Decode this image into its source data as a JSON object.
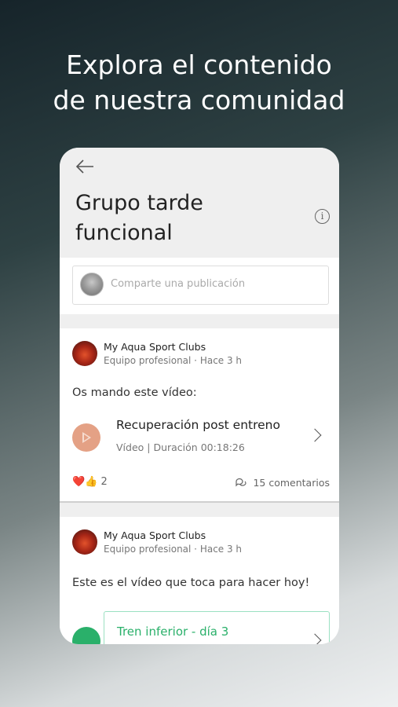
{
  "headline": {
    "line1": "Explora el contenido",
    "line2": "de nuestra comunidad"
  },
  "screen": {
    "title_line1": "Grupo tarde",
    "title_line2": "funcional",
    "composer_placeholder": "Comparte una publicación"
  },
  "posts": [
    {
      "author": "My Aqua Sport Clubs",
      "meta": "Equipo profesional · Hace 3 h",
      "text": "Os mando este vídeo:",
      "video_title": "Recuperación post entreno",
      "video_meta": "Vídeo | Duración 00:18:26",
      "reactions": "❤️👍",
      "reaction_count": "2",
      "comments": "15 comentarios"
    },
    {
      "author": "My Aqua Sport Clubs",
      "meta": "Equipo profesional · Hace 3 h",
      "text": "Este es el vídeo que toca para hacer hoy!",
      "workout_title": "Tren inferior - día 3"
    }
  ],
  "colors": {
    "accent_green": "#2ab06a",
    "play_button": "#e4a185"
  },
  "icons": {
    "back": "back-arrow-icon",
    "info": "info-icon",
    "play": "play-icon",
    "comment": "comment-icon",
    "chevron": "chevron-right-icon",
    "check": "check-icon"
  }
}
